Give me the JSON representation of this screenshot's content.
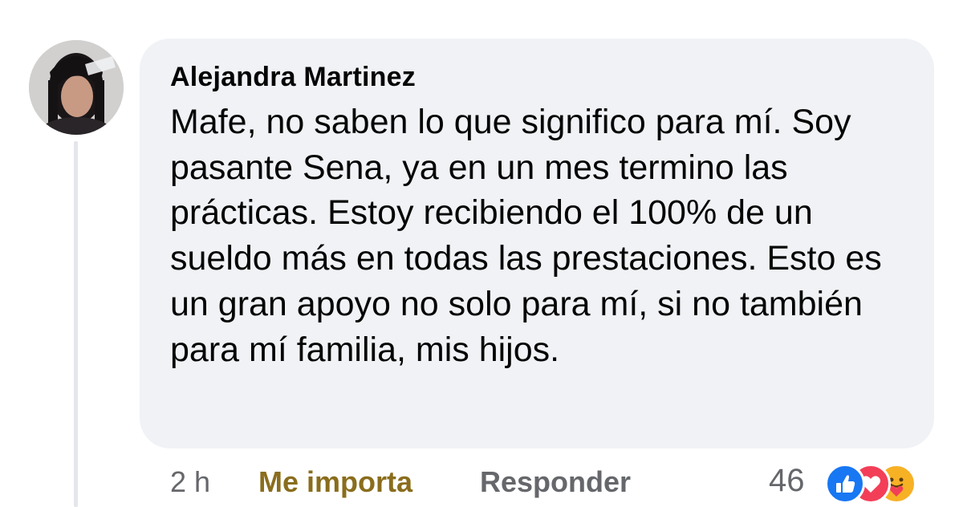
{
  "comment": {
    "author": "Alejandra Martinez",
    "text": "Mafe, no saben lo que significo para mí. Soy pasante Sena, ya en un mes termino las prácticas. Estoy recibiendo el 100% de un sueldo más en todas las prestaciones. Esto es un gran apoyo no solo para mí, si no también para mí familia, mis hijos.",
    "timestamp": "2 h",
    "like_action_label": "Me importa",
    "reply_action_label": "Responder",
    "reaction_count": "46",
    "reactions": [
      "like-icon",
      "love-icon",
      "care-icon"
    ]
  },
  "colors": {
    "bubble_background": "#f0f2f5",
    "selected_reaction": "#8a6d1d",
    "secondary_text": "#65676b",
    "like_blue": "#1877f2",
    "love_red": "#f33e58",
    "care_yellow": "#f7b125"
  }
}
